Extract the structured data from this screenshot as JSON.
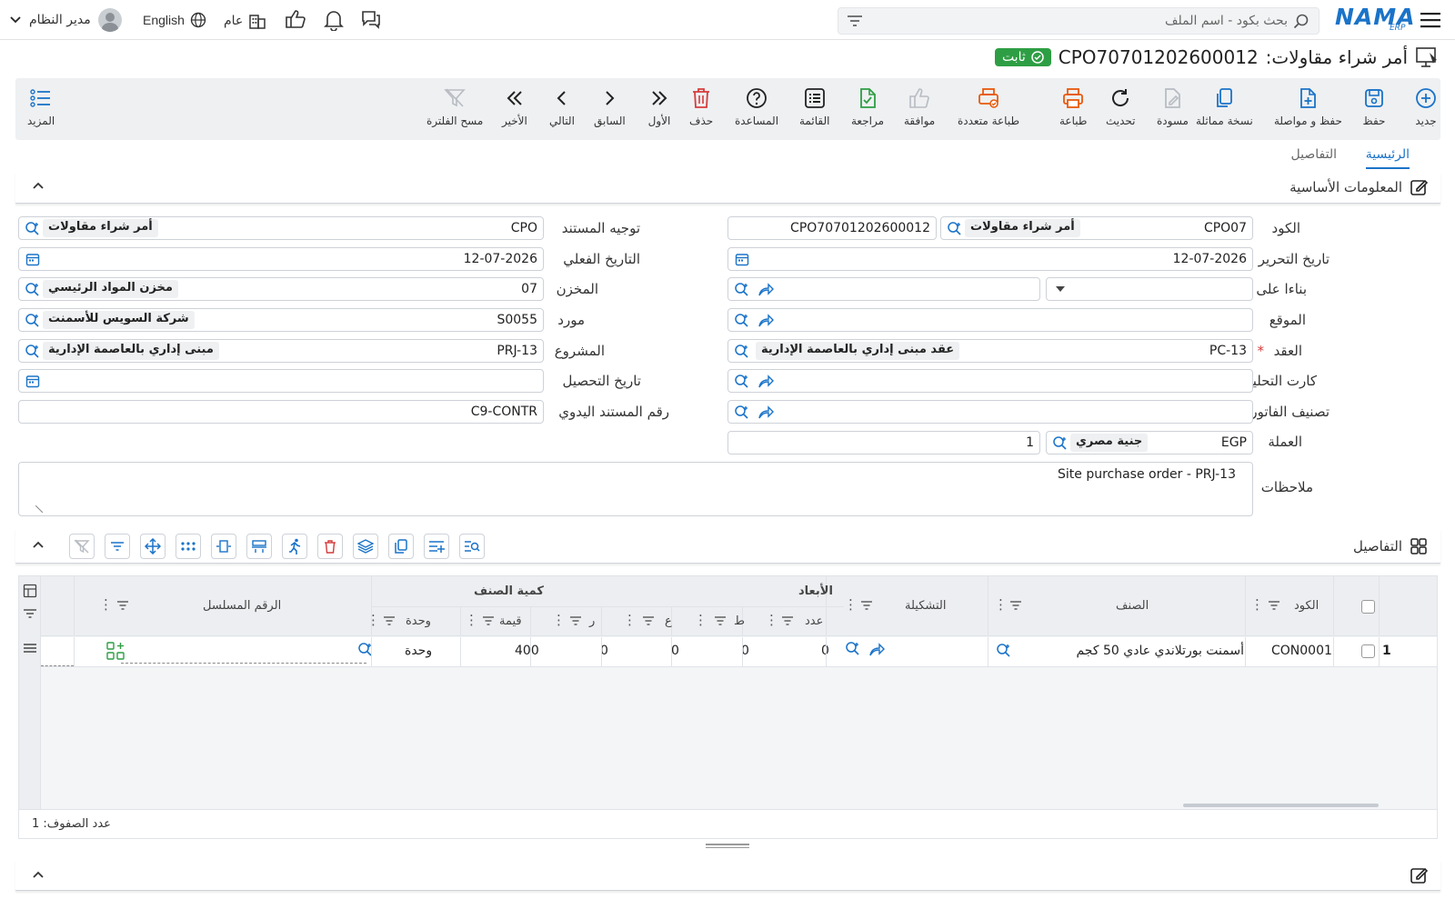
{
  "topbar": {
    "brand": "NAMA",
    "brand_sub": "ERP",
    "search_placeholder": "بحث بكود - اسم الملف",
    "language": "English",
    "company": "عام",
    "user": "مدير النظام"
  },
  "title": {
    "doc_type": "أمر شراء مقاولات:",
    "doc_code": "CPO70701202600012",
    "status": "ثابت"
  },
  "toolbar": {
    "new": "جديد",
    "save": "حفظ",
    "save_continue": "حفظ و مواصلة",
    "duplicate": "نسخة مماثلة",
    "draft": "مسودة",
    "refresh": "تحديث",
    "print": "طباعة",
    "multi_print": "طباعة متعددة",
    "approve": "موافقة",
    "review": "مراجعة",
    "list": "القائمة",
    "help": "المساعدة",
    "delete": "حذف",
    "first": "الأول",
    "prev": "السابق",
    "next": "التالي",
    "last": "الأخير",
    "clear_filter": "مسح الفلترة",
    "more": "المزيد"
  },
  "tabs": {
    "main": "الرئيسية",
    "details": "التفاصيل"
  },
  "basic_section": {
    "title": "المعلومات الأساسية"
  },
  "form": {
    "code": {
      "label": "الكود",
      "value": "CPO07",
      "chip": "أمر شراء مقاولات",
      "number": "CPO70701202600012"
    },
    "doc_direction": {
      "label": "توجيه المستند",
      "value": "CPO",
      "chip": "أمر شراء مقاولات"
    },
    "edit_date": {
      "label": "تاريخ التحرير",
      "value": "12-07-2026"
    },
    "actual_date": {
      "label": "التاريخ الفعلي",
      "value": "12-07-2026"
    },
    "based_on": {
      "label": "بناءا على"
    },
    "warehouse": {
      "label": "المخزن",
      "value": "07",
      "chip": "مخزن المواد الرئيسي"
    },
    "location": {
      "label": "الموقع"
    },
    "supplier": {
      "label": "مورد",
      "value": "S0055",
      "chip": "شركة السويس للأسمنت"
    },
    "contract": {
      "label": "العقد",
      "required": "*",
      "value": "PC-13",
      "chip": "عقد مبنى إداري بالعاصمة الإدارية"
    },
    "project": {
      "label": "المشروع",
      "value": "PRJ-13",
      "chip": "مبنى إداري بالعاصمة الإدارية"
    },
    "analysis_card": {
      "label": "كارت التحليل"
    },
    "collection_date": {
      "label": "تاريخ التحصيل"
    },
    "invoice_class": {
      "label": "تصنيف الفاتورة"
    },
    "manual_doc": {
      "label": "رقم المستند اليدوي",
      "value": "C9-CONTR"
    },
    "currency": {
      "label": "العملة",
      "value": "EGP",
      "chip": "جنية مصري",
      "rate": "1"
    },
    "notes": {
      "label": "ملاحظات",
      "value": "Site purchase order - PRJ-13"
    }
  },
  "details_section": {
    "title": "التفاصيل"
  },
  "grid": {
    "headers": {
      "code": "الكود",
      "item": "الصنف",
      "config": "التشكيلة",
      "dimensions": "الأبعاد",
      "count": "عدد",
      "t": "ط",
      "a": "ع",
      "r": "ر",
      "qty_group": "كمية الصنف",
      "value": "قيمة",
      "unit": "وحدة",
      "serial": "الرقم المسلسل"
    },
    "rows": [
      {
        "num": "1",
        "code": "CON0001",
        "item": "أسمنت بورتلاندي عادي 50 كجم",
        "count": "0",
        "t": "0",
        "a": "0",
        "r": "0",
        "value": "400",
        "unit": "وحدة"
      }
    ],
    "footer": "عدد الصفوف: 1"
  },
  "colors": {
    "accent": "#1a73c8",
    "status_green": "#2e9e44",
    "print_orange": "#e8590c",
    "delete_red": "#d63b3b"
  }
}
